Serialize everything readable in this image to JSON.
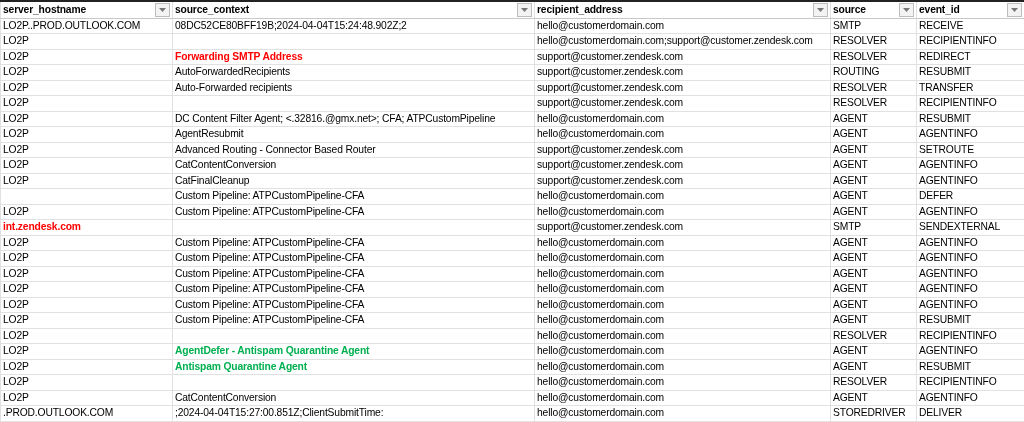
{
  "table": {
    "columns": [
      "server_hostname",
      "source_context",
      "recipient_address",
      "source",
      "event_id"
    ],
    "rows": [
      [
        "LO2P..PROD.OUTLOOK.COM",
        "08DC52CE80BFF19B;2024-04-04T15:24:48.902Z;2",
        "hello@customerdomain.com",
        "SMTP",
        "RECEIVE"
      ],
      [
        "LO2P",
        null,
        "hello@customerdomain.com;support@customer.zendesk.com",
        "RESOLVER",
        "RECIPIENTINFO"
      ],
      [
        "LO2P",
        {
          "text": "Forwarding SMTP Address",
          "color": "#ff0000"
        },
        "support@customer.zendesk.com",
        "RESOLVER",
        "REDIRECT"
      ],
      [
        "LO2P",
        "AutoForwardedRecipients",
        "support@customer.zendesk.com",
        "ROUTING",
        "RESUBMIT"
      ],
      [
        "LO2P",
        "Auto-Forwarded recipients",
        "support@customer.zendesk.com",
        "RESOLVER",
        "TRANSFER"
      ],
      [
        "LO2P",
        null,
        "support@customer.zendesk.com",
        "RESOLVER",
        "RECIPIENTINFO"
      ],
      [
        "LO2P",
        "DC Content Filter Agent; <.32816.@gmx.net>; CFA; ATPCustomPipeline",
        "hello@customerdomain.com",
        "AGENT",
        "RESUBMIT"
      ],
      [
        "LO2P",
        "AgentResubmit",
        "hello@customerdomain.com",
        "AGENT",
        "AGENTINFO"
      ],
      [
        "LO2P",
        "Advanced Routing - Connector Based Router",
        "support@customer.zendesk.com",
        "AGENT",
        "SETROUTE"
      ],
      [
        "LO2P",
        "CatContentConversion",
        "support@customer.zendesk.com",
        "AGENT",
        "AGENTINFO"
      ],
      [
        "LO2P",
        "CatFinalCleanup",
        "support@customer.zendesk.com",
        "AGENT",
        "AGENTINFO"
      ],
      [
        null,
        "Custom Pipeline: ATPCustomPipeline-CFA",
        "hello@customerdomain.com",
        "AGENT",
        "DEFER"
      ],
      [
        "LO2P",
        "Custom Pipeline: ATPCustomPipeline-CFA",
        "hello@customerdomain.com",
        "AGENT",
        "AGENTINFO"
      ],
      [
        {
          "text": "int.zendesk.com",
          "color": "#ff0000"
        },
        null,
        "support@customer.zendesk.com",
        "SMTP",
        "SENDEXTERNAL"
      ],
      [
        "LO2P",
        "Custom Pipeline: ATPCustomPipeline-CFA",
        "hello@customerdomain.com",
        "AGENT",
        "AGENTINFO"
      ],
      [
        "LO2P",
        "Custom Pipeline: ATPCustomPipeline-CFA",
        "hello@customerdomain.com",
        "AGENT",
        "AGENTINFO"
      ],
      [
        "LO2P",
        "Custom Pipeline: ATPCustomPipeline-CFA",
        "hello@customerdomain.com",
        "AGENT",
        "AGENTINFO"
      ],
      [
        "LO2P",
        "Custom Pipeline: ATPCustomPipeline-CFA",
        "hello@customerdomain.com",
        "AGENT",
        "AGENTINFO"
      ],
      [
        "LO2P",
        "Custom Pipeline: ATPCustomPipeline-CFA",
        "hello@customerdomain.com",
        "AGENT",
        "AGENTINFO"
      ],
      [
        "LO2P",
        "Custom Pipeline: ATPCustomPipeline-CFA",
        "hello@customerdomain.com",
        "AGENT",
        "RESUBMIT"
      ],
      [
        "LO2P",
        null,
        "hello@customerdomain.com",
        "RESOLVER",
        "RECIPIENTINFO"
      ],
      [
        "LO2P",
        {
          "text": "AgentDefer - Antispam Quarantine Agent",
          "color": "#00b050"
        },
        "hello@customerdomain.com",
        "AGENT",
        "AGENTINFO"
      ],
      [
        "LO2P",
        {
          "text": "Antispam Quarantine Agent",
          "color": "#00b050"
        },
        "hello@customerdomain.com",
        "AGENT",
        "RESUBMIT"
      ],
      [
        "LO2P",
        null,
        "hello@customerdomain.com",
        "RESOLVER",
        "RECIPIENTINFO"
      ],
      [
        "LO2P",
        "CatContentConversion",
        "hello@customerdomain.com",
        "AGENT",
        "AGENTINFO"
      ],
      [
        ".PROD.OUTLOOK.COM",
        ";2024-04-04T15:27:00.851Z;ClientSubmitTime:",
        "hello@customerdomain.com",
        "STOREDRIVER",
        "DELIVER"
      ]
    ]
  }
}
